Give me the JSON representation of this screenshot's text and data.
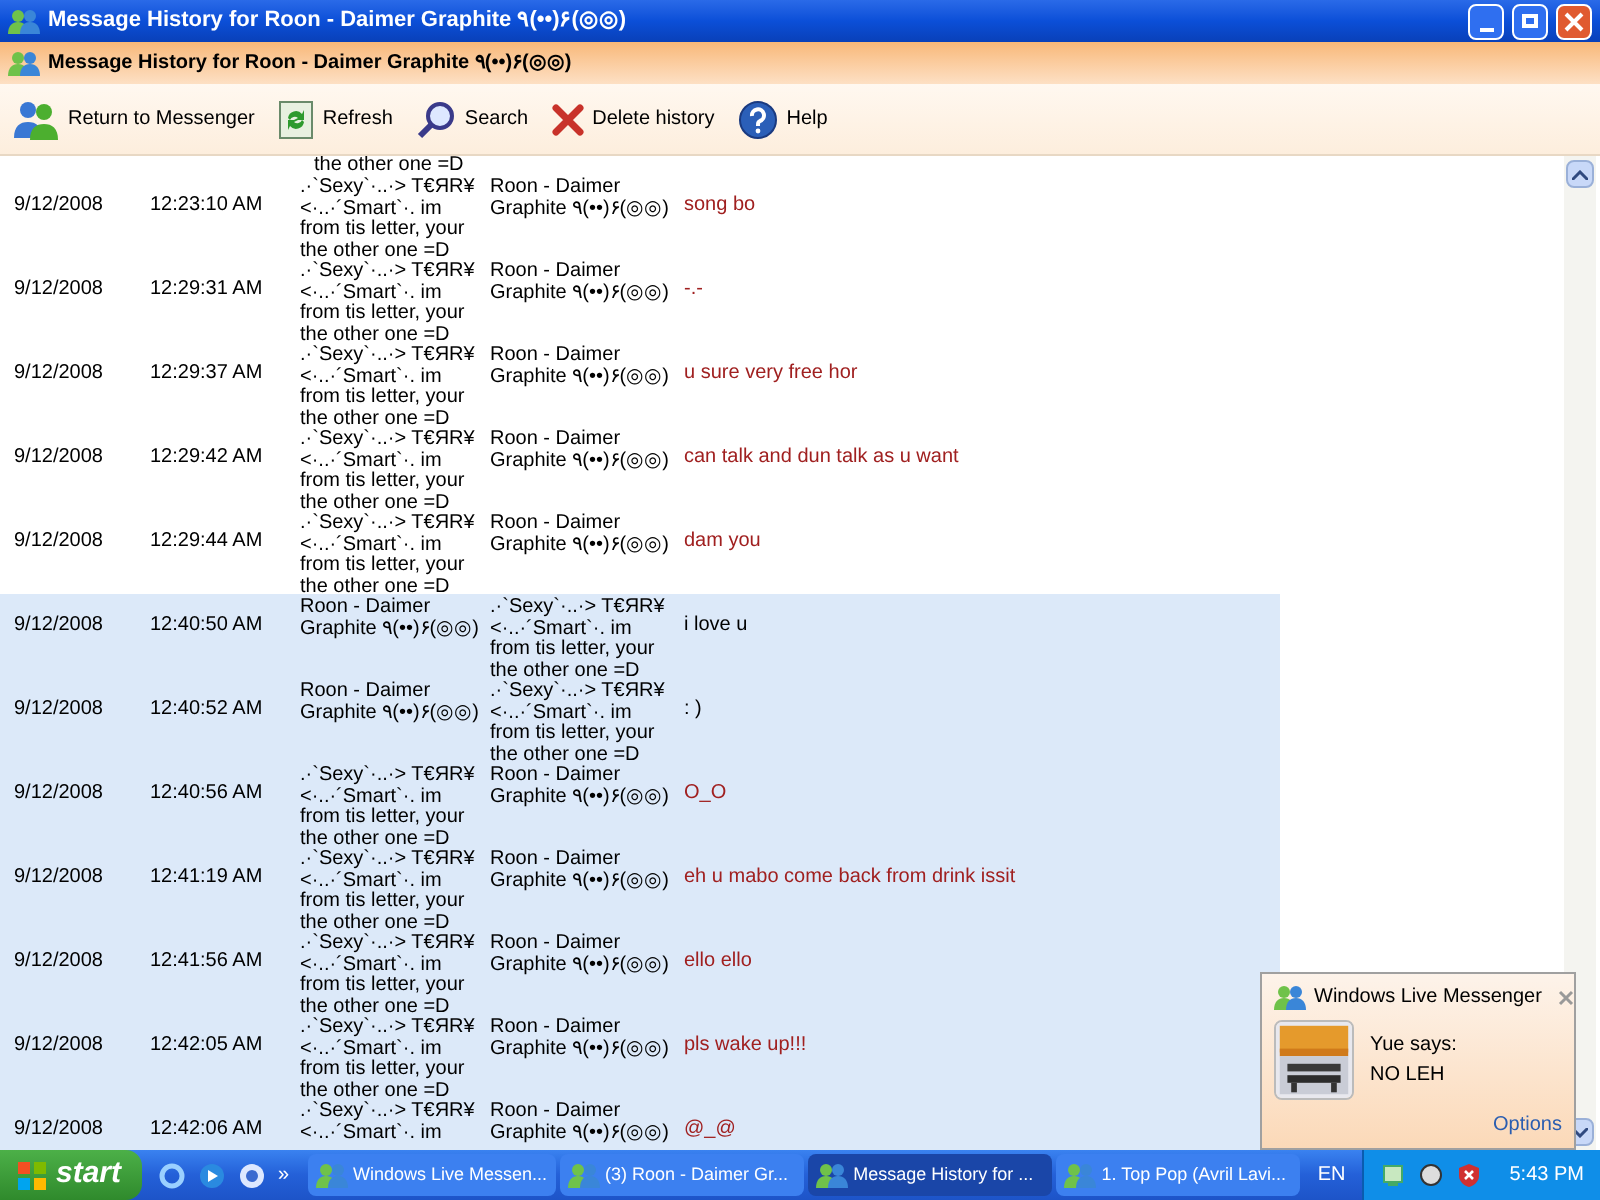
{
  "window": {
    "title": "Message History for Roon - Daimer Graphite ٩(••)۶(◎◎)"
  },
  "header": {
    "title": "Message History for Roon - Daimer Graphite ٩(••)۶(◎◎)"
  },
  "toolbar": [
    {
      "kind": "people",
      "label": "Return to Messenger"
    },
    {
      "kind": "refresh",
      "label": "Refresh"
    },
    {
      "kind": "search",
      "label": "Search"
    },
    {
      "kind": "delete",
      "label": "Delete history"
    },
    {
      "kind": "help",
      "label": "Help"
    }
  ],
  "history": {
    "cut_line": "the other one =D",
    "rows": [
      {
        "date": "9/12/2008",
        "time": "12:23:10 AM",
        "from": ".·`Sexy`·..·> T€ЯR¥ <·..·´Smart`·. im from tis letter, your the other one =D",
        "to": "Roon - Daimer Graphite ٩(••)۶(◎◎)",
        "message": "song bo",
        "from_contact": true,
        "selected": false
      },
      {
        "date": "9/12/2008",
        "time": "12:29:31 AM",
        "from": ".·`Sexy`·..·> T€ЯR¥ <·..·´Smart`·. im from tis letter, your the other one =D",
        "to": "Roon - Daimer Graphite ٩(••)۶(◎◎)",
        "message": "-.-",
        "from_contact": true,
        "selected": false
      },
      {
        "date": "9/12/2008",
        "time": "12:29:37 AM",
        "from": ".·`Sexy`·..·> T€ЯR¥ <·..·´Smart`·. im from tis letter, your the other one =D",
        "to": "Roon - Daimer Graphite ٩(••)۶(◎◎)",
        "message": "u sure very free hor",
        "from_contact": true,
        "selected": false
      },
      {
        "date": "9/12/2008",
        "time": "12:29:42 AM",
        "from": ".·`Sexy`·..·> T€ЯR¥ <·..·´Smart`·. im from tis letter, your the other one =D",
        "to": "Roon - Daimer Graphite ٩(••)۶(◎◎)",
        "message": "can talk and dun talk as u want",
        "from_contact": true,
        "selected": false
      },
      {
        "date": "9/12/2008",
        "time": "12:29:44 AM",
        "from": ".·`Sexy`·..·> T€ЯR¥ <·..·´Smart`·. im from tis letter, your the other one =D",
        "to": "Roon - Daimer Graphite ٩(••)۶(◎◎)",
        "message": "dam you",
        "from_contact": true,
        "selected": false
      },
      {
        "date": "9/12/2008",
        "time": "12:40:50 AM",
        "from": "Roon - Daimer Graphite ٩(••)۶(◎◎)",
        "to": ".·`Sexy`·..·> T€ЯR¥ <·..·´Smart`·. im from tis letter, your the other one =D",
        "message": "i love u",
        "from_contact": false,
        "selected": true
      },
      {
        "date": "9/12/2008",
        "time": "12:40:52 AM",
        "from": "Roon - Daimer Graphite ٩(••)۶(◎◎)",
        "to": ".·`Sexy`·..·> T€ЯR¥ <·..·´Smart`·. im from tis letter, your the other one =D",
        "message": ": )",
        "from_contact": false,
        "selected": true
      },
      {
        "date": "9/12/2008",
        "time": "12:40:56 AM",
        "from": ".·`Sexy`·..·> T€ЯR¥ <·..·´Smart`·. im from tis letter, your the other one =D",
        "to": "Roon - Daimer Graphite ٩(••)۶(◎◎)",
        "message": "O_O",
        "from_contact": true,
        "selected": true
      },
      {
        "date": "9/12/2008",
        "time": "12:41:19 AM",
        "from": ".·`Sexy`·..·> T€ЯR¥ <·..·´Smart`·. im from tis letter, your the other one =D",
        "to": "Roon - Daimer Graphite ٩(••)۶(◎◎)",
        "message": "eh u mabo come back from drink issit",
        "from_contact": true,
        "selected": true
      },
      {
        "date": "9/12/2008",
        "time": "12:41:56 AM",
        "from": ".·`Sexy`·..·> T€ЯR¥ <·..·´Smart`·. im from tis letter, your the other one =D",
        "to": "Roon - Daimer Graphite ٩(••)۶(◎◎)",
        "message": "ello ello",
        "from_contact": true,
        "selected": true
      },
      {
        "date": "9/12/2008",
        "time": "12:42:05 AM",
        "from": ".·`Sexy`·..·> T€ЯR¥ <·..·´Smart`·. im from tis letter, your the other one =D",
        "to": "Roon - Daimer Graphite ٩(••)۶(◎◎)",
        "message": "pls wake up!!!",
        "from_contact": true,
        "selected": true
      },
      {
        "date": "9/12/2008",
        "time": "12:42:06 AM",
        "from": ".·`Sexy`·..·> T€ЯR¥ <·..·´Smart`·. im",
        "to": "Roon - Daimer Graphite ٩(••)۶(◎◎)",
        "message": "@_@",
        "from_contact": true,
        "selected": true
      }
    ]
  },
  "popup": {
    "title": "Windows Live Messenger",
    "line_1": "Yue says:",
    "line_2": "NO LEH",
    "link": "Options"
  },
  "taskbar": {
    "start": "start",
    "quick_more": "»",
    "tasks": [
      {
        "label": "Windows Live Messen...",
        "selected": false
      },
      {
        "label": "(3) Roon - Daimer Gr...",
        "selected": false
      },
      {
        "label": "Message History for ...",
        "selected": true
      },
      {
        "label": "1. Top Pop (Avril Lavi...",
        "selected": false
      }
    ],
    "language": "EN",
    "clock": "5:43 PM"
  }
}
